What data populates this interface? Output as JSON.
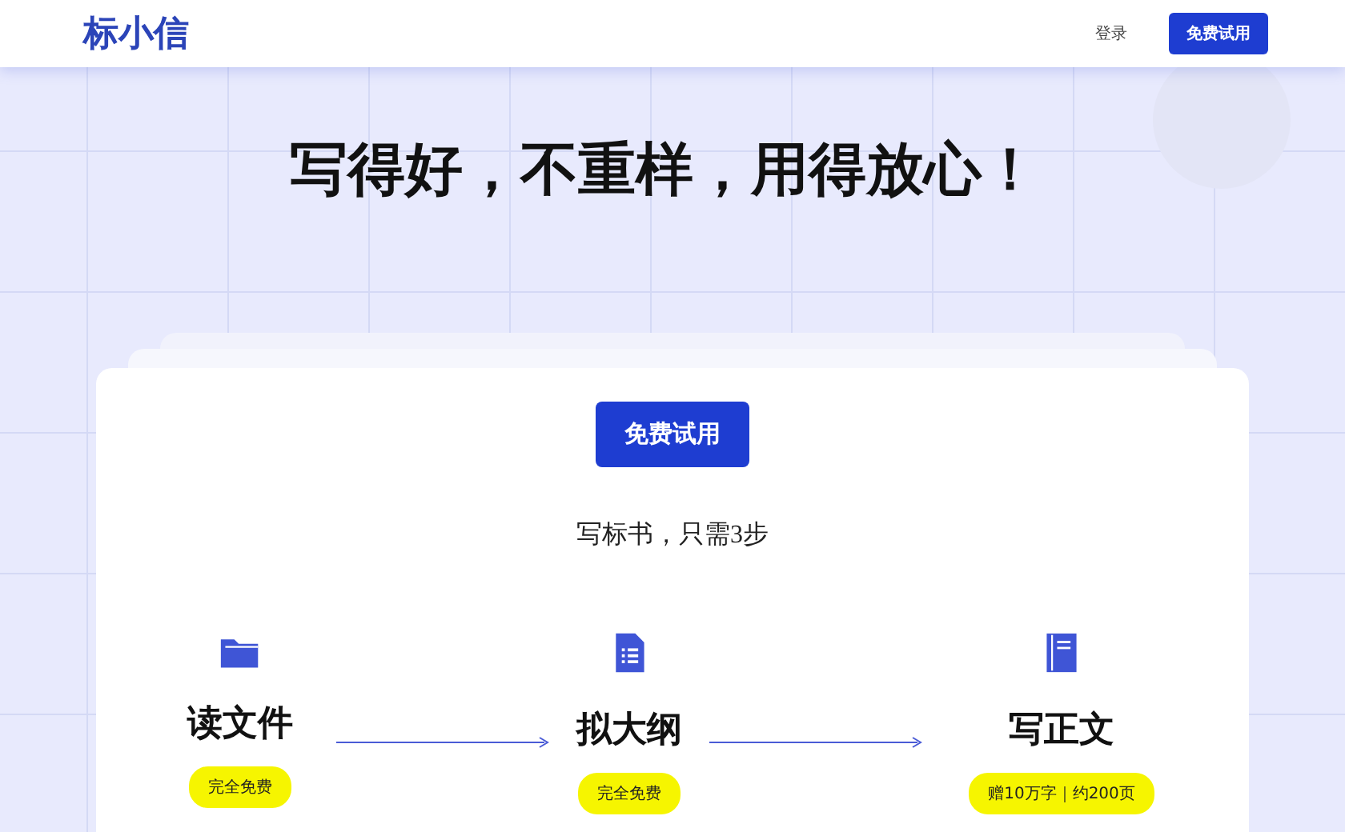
{
  "header": {
    "logo": "标小信",
    "login": "登录",
    "cta": "免费试用"
  },
  "hero": {
    "headline": "写得好，不重样，用得放心！"
  },
  "card": {
    "cta": "免费试用",
    "subtitle": "写标书，只需3步",
    "steps": [
      {
        "kind": "folder",
        "title": "读文件",
        "badge": "完全免费"
      },
      {
        "kind": "outline",
        "title": "拟大纲",
        "badge": "完全免费"
      },
      {
        "kind": "book",
        "title": "写正文",
        "badge": "赠10万字｜约200页"
      }
    ]
  }
}
